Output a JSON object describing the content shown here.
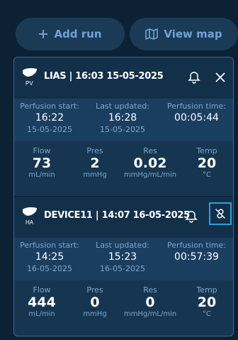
{
  "toolbar": {
    "add_run_label": "Add run",
    "view_map_label": "View map"
  },
  "cards": [
    {
      "organ_badge": "PV",
      "title": "LIAS | 16:03 15-05-2025",
      "perfusion_start_label": "Perfusion start:",
      "perfusion_start_time": "16:22",
      "perfusion_start_date": "15-05-2025",
      "last_updated_label": "Last updated:",
      "last_updated_time": "16:28",
      "last_updated_date": "15-05-2025",
      "perfusion_time_label": "Perfusion time:",
      "perfusion_time_value": "00:05:44",
      "metrics": [
        {
          "label": "Flow",
          "value": "73",
          "unit": "mL/min"
        },
        {
          "label": "Pres",
          "value": "2",
          "unit": "mmHg"
        },
        {
          "label": "Res",
          "value": "0.02",
          "unit": "mmHg/mL/min"
        },
        {
          "label": "Temp",
          "value": "20",
          "unit": "°C"
        }
      ]
    },
    {
      "organ_badge": "HA",
      "title": "DEVICE11 | 14:07 16-05-2025",
      "perfusion_start_label": "Perfusion start:",
      "perfusion_start_time": "14:25",
      "perfusion_start_date": "16-05-2025",
      "last_updated_label": "Last updated:",
      "last_updated_time": "15:23",
      "last_updated_date": "16-05-2025",
      "perfusion_time_label": "Perfusion time:",
      "perfusion_time_value": "00:57:39",
      "metrics": [
        {
          "label": "Flow",
          "value": "444",
          "unit": "mL/min"
        },
        {
          "label": "Pres",
          "value": "0",
          "unit": "mmHg"
        },
        {
          "label": "Res",
          "value": "0",
          "unit": "mmHg/mL/min"
        },
        {
          "label": "Temp",
          "value": "20",
          "unit": "°C"
        }
      ]
    }
  ],
  "icons": {
    "add": "plus-icon",
    "map": "map-icon",
    "organ": "liver-icon",
    "bell": "bell-icon",
    "close": "close-icon",
    "unlink": "unlink-icon"
  },
  "colors": {
    "background": "#0c2234",
    "card_header": "#12304a",
    "times_band": "#1a3e60",
    "accent": "#6fa3d8",
    "highlight_border": "#2f9fd6"
  }
}
